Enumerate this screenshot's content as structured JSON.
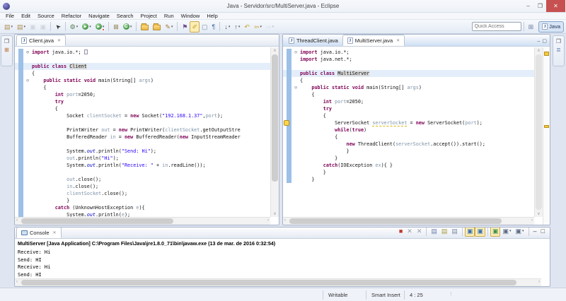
{
  "window": {
    "title": "Java - Servidor/src/MultiServer.java - Eclipse",
    "controls": [
      {
        "name": "minimize-button",
        "glyph": "–"
      },
      {
        "name": "maximize-button",
        "glyph": "❐"
      },
      {
        "name": "close-button",
        "glyph": "✕",
        "close": true
      }
    ]
  },
  "menu": {
    "items": [
      "File",
      "Edit",
      "Source",
      "Refactor",
      "Navigate",
      "Search",
      "Project",
      "Run",
      "Window",
      "Help"
    ]
  },
  "toolbar": {
    "quick_access_placeholder": "Quick Access",
    "perspective": {
      "label": "Java"
    },
    "open_perspective_icon": "⊞",
    "icons": [
      {
        "n": "new-wizard-dropdown",
        "g": "▤",
        "c": "#b08d4e",
        "d": 1
      },
      {
        "n": "new-project-dropdown",
        "g": "▤",
        "c": "#b08d4e",
        "d": 1
      },
      {
        "n": "save-button",
        "g": "▣",
        "c": "#9aa3b0",
        "dis": 1
      },
      {
        "n": "save-all-button",
        "g": "▣",
        "c": "#9aa3b0",
        "dis": 1
      },
      {
        "sep": 1
      },
      {
        "n": "selection-tool-button",
        "g": "➤",
        "c": "#333",
        "rot": -135
      },
      {
        "sep": 1
      },
      {
        "n": "debug-dropdown",
        "g": "⚙",
        "c": "#4f7b4f",
        "d": 1
      },
      {
        "n": "run-dropdown",
        "k": "run",
        "d": 1
      },
      {
        "n": "external-tools-dropdown",
        "k": "ext",
        "d": 1
      },
      {
        "sep": 1
      },
      {
        "n": "new-java-project-button",
        "g": "⊞",
        "c": "#8a6d3b"
      },
      {
        "n": "new-java-class-dropdown",
        "k": "class",
        "d": 1
      },
      {
        "sep": 1
      },
      {
        "n": "open-element-button",
        "k": "folder"
      },
      {
        "n": "open-resource-button",
        "k": "folder"
      },
      {
        "n": "new-task-dropdown",
        "g": "✎",
        "c": "#a8762e",
        "d": 1
      },
      {
        "sep": 1
      },
      {
        "n": "block-selection-toggle",
        "g": "⚑",
        "c": "#6d4c8f"
      },
      {
        "n": "mark-occurrences-toggle",
        "g": "✐",
        "c": "#c9a227",
        "p": 1
      },
      {
        "n": "show-selected-element-toggle",
        "g": "▢",
        "c": "#7a8aa5"
      },
      {
        "n": "show-whitespace-toggle",
        "g": "¶",
        "c": "#4a6fa5"
      },
      {
        "sep": 1
      },
      {
        "n": "next-annotation-dropdown",
        "g": "↓",
        "c": "#555",
        "d": 1
      },
      {
        "n": "previous-annotation-dropdown",
        "g": "↑",
        "c": "#555",
        "d": 1
      },
      {
        "n": "last-edit-location-button",
        "g": "↶",
        "c": "#c9a227"
      },
      {
        "n": "back-dropdown",
        "g": "⇦",
        "c": "#c9a227",
        "d": 1
      },
      {
        "n": "forward-dropdown",
        "g": "⇨",
        "c": "#b9c0cc",
        "d": 1,
        "dis": 1
      }
    ]
  },
  "minimized_panels": {
    "left": [
      {
        "name": "restore-view-icon",
        "g": "❐",
        "c": "#556"
      },
      {
        "name": "package-explorer-icon",
        "g": "⊞",
        "c": "#b5651d"
      }
    ],
    "right": [
      {
        "name": "restore-view-icon",
        "g": "❐",
        "c": "#556"
      },
      {
        "name": "outline-icon",
        "g": "≣",
        "c": "#4a6fa5"
      }
    ]
  },
  "editors": {
    "left": {
      "tabs": [
        {
          "label": "Client.java",
          "active": true
        }
      ],
      "lines": [
        {
          "fold": "plus",
          "seg": [
            [
              "import",
              "kw"
            ],
            [
              " java.io.*; ",
              "pl"
            ],
            [
              "",
              "foldbox"
            ]
          ]
        },
        {
          "seg": []
        },
        {
          "hl": true,
          "seg": [
            [
              "public",
              "kw"
            ],
            [
              " ",
              "pl"
            ],
            [
              "class",
              "kw"
            ],
            [
              " ",
              "pl"
            ],
            [
              "Client",
              "occ"
            ]
          ]
        },
        {
          "seg": [
            [
              "{",
              "pl"
            ]
          ]
        },
        {
          "fold": "minus",
          "seg": [
            [
              "    ",
              "pl"
            ],
            [
              "public",
              "kw"
            ],
            [
              " ",
              "pl"
            ],
            [
              "static",
              "kw"
            ],
            [
              " ",
              "pl"
            ],
            [
              "void",
              "kw"
            ],
            [
              " main(String[] ",
              "pl"
            ],
            [
              "args",
              "var"
            ],
            [
              ")",
              "pl"
            ]
          ]
        },
        {
          "seg": [
            [
              "    {",
              "pl"
            ]
          ]
        },
        {
          "seg": [
            [
              "        ",
              "pl"
            ],
            [
              "int",
              "kw"
            ],
            [
              " ",
              "pl"
            ],
            [
              "port",
              "var"
            ],
            [
              "=2050;",
              "pl"
            ]
          ]
        },
        {
          "seg": [
            [
              "        ",
              "pl"
            ],
            [
              "try",
              "kw"
            ]
          ]
        },
        {
          "seg": [
            [
              "        {",
              "pl"
            ]
          ]
        },
        {
          "seg": [
            [
              "            Socket ",
              "pl"
            ],
            [
              "clientSocket",
              "var"
            ],
            [
              " = ",
              "pl"
            ],
            [
              "new",
              "kw"
            ],
            [
              " Socket(",
              "pl"
            ],
            [
              "\"192.168.1.37\"",
              "str"
            ],
            [
              ",",
              "pl"
            ],
            [
              "port",
              "var"
            ],
            [
              ");",
              "pl"
            ]
          ]
        },
        {
          "seg": []
        },
        {
          "seg": [
            [
              "            PrintWriter ",
              "pl"
            ],
            [
              "out",
              "var"
            ],
            [
              " = ",
              "pl"
            ],
            [
              "new",
              "kw"
            ],
            [
              " PrintWriter(",
              "pl"
            ],
            [
              "clientSocket",
              "var"
            ],
            [
              ".getOutputStre",
              "pl"
            ]
          ]
        },
        {
          "seg": [
            [
              "            BufferedReader ",
              "pl"
            ],
            [
              "in",
              "var"
            ],
            [
              " = ",
              "pl"
            ],
            [
              "new",
              "kw"
            ],
            [
              " BufferedReader(",
              "pl"
            ],
            [
              "new",
              "kw"
            ],
            [
              " InputStreamReader",
              "pl"
            ]
          ]
        },
        {
          "seg": []
        },
        {
          "seg": [
            [
              "            System.",
              "pl"
            ],
            [
              "out",
              "fld"
            ],
            [
              ".println(",
              "pl"
            ],
            [
              "\"Send: Hi\"",
              "str"
            ],
            [
              ");",
              "pl"
            ]
          ]
        },
        {
          "seg": [
            [
              "            ",
              "pl"
            ],
            [
              "out",
              "var"
            ],
            [
              ".println(",
              "pl"
            ],
            [
              "\"Hi\"",
              "str"
            ],
            [
              ");",
              "pl"
            ]
          ]
        },
        {
          "seg": [
            [
              "            System.",
              "pl"
            ],
            [
              "out",
              "fld"
            ],
            [
              ".println(",
              "pl"
            ],
            [
              "\"Receive: \"",
              "str"
            ],
            [
              " + ",
              "pl"
            ],
            [
              "in",
              "var"
            ],
            [
              ".readLine());",
              "pl"
            ]
          ]
        },
        {
          "seg": []
        },
        {
          "seg": [
            [
              "            ",
              "pl"
            ],
            [
              "out",
              "var"
            ],
            [
              ".close();",
              "pl"
            ]
          ]
        },
        {
          "seg": [
            [
              "            ",
              "pl"
            ],
            [
              "in",
              "var"
            ],
            [
              ".close();",
              "pl"
            ]
          ]
        },
        {
          "seg": [
            [
              "            ",
              "pl"
            ],
            [
              "clientSocket",
              "var"
            ],
            [
              ".close();",
              "pl"
            ]
          ]
        },
        {
          "seg": [
            [
              "            }",
              "pl"
            ]
          ]
        },
        {
          "seg": [
            [
              "        ",
              "pl"
            ],
            [
              "catch",
              "kw"
            ],
            [
              " (UnknownHostException ",
              "pl"
            ],
            [
              "e",
              "var"
            ],
            [
              "){",
              "pl"
            ]
          ]
        },
        {
          "seg": [
            [
              "            System.",
              "pl"
            ],
            [
              "out",
              "fld"
            ],
            [
              ".println(",
              "pl"
            ],
            [
              "e",
              "var"
            ],
            [
              ");",
              "pl"
            ]
          ]
        }
      ]
    },
    "right": {
      "tabs": [
        {
          "label": "ThreadClient.java",
          "active": false
        },
        {
          "label": "MultiServer.java",
          "active": true
        }
      ],
      "lines": [
        {
          "fold": "minus",
          "seg": [
            [
              "import",
              "kw"
            ],
            [
              " java.io.*;",
              "pl"
            ]
          ]
        },
        {
          "seg": [
            [
              "import",
              "kw"
            ],
            [
              " java.net.*;",
              "pl"
            ]
          ]
        },
        {
          "seg": []
        },
        {
          "hl": true,
          "seg": [
            [
              "public",
              "kw"
            ],
            [
              " ",
              "pl"
            ],
            [
              "class",
              "kw"
            ],
            [
              " ",
              "pl"
            ],
            [
              "MultiServer",
              "occ"
            ]
          ]
        },
        {
          "seg": [
            [
              "{",
              "pl"
            ]
          ]
        },
        {
          "fold": "minus",
          "seg": [
            [
              "    ",
              "pl"
            ],
            [
              "public",
              "kw"
            ],
            [
              " ",
              "pl"
            ],
            [
              "static",
              "kw"
            ],
            [
              " ",
              "pl"
            ],
            [
              "void",
              "kw"
            ],
            [
              " main(String[] ",
              "pl"
            ],
            [
              "args",
              "var"
            ],
            [
              ")",
              "pl"
            ]
          ]
        },
        {
          "seg": [
            [
              "    {",
              "pl"
            ]
          ]
        },
        {
          "seg": [
            [
              "        ",
              "pl"
            ],
            [
              "int",
              "kw"
            ],
            [
              " ",
              "pl"
            ],
            [
              "port",
              "var"
            ],
            [
              "=2050;",
              "pl"
            ]
          ]
        },
        {
          "seg": [
            [
              "        ",
              "pl"
            ],
            [
              "try",
              "kw"
            ]
          ]
        },
        {
          "seg": [
            [
              "        {",
              "pl"
            ]
          ]
        },
        {
          "warn": true,
          "seg": [
            [
              "            ServerSocket ",
              "pl"
            ],
            [
              "serverSocket",
              "warnvar"
            ],
            [
              " = ",
              "pl"
            ],
            [
              "new",
              "kw"
            ],
            [
              " ServerSocket(",
              "pl"
            ],
            [
              "port",
              "var"
            ],
            [
              ");",
              "pl"
            ]
          ]
        },
        {
          "seg": [
            [
              "            ",
              "pl"
            ],
            [
              "while",
              "kw"
            ],
            [
              "(",
              "pl"
            ],
            [
              "true",
              "kw"
            ],
            [
              ")",
              "pl"
            ]
          ]
        },
        {
          "seg": [
            [
              "            {",
              "pl"
            ]
          ]
        },
        {
          "seg": [
            [
              "                ",
              "pl"
            ],
            [
              "new",
              "kw"
            ],
            [
              " ThreadClient(",
              "pl"
            ],
            [
              "serverSocket",
              "var"
            ],
            [
              ".accept()).start();",
              "pl"
            ]
          ]
        },
        {
          "seg": [
            [
              "                }",
              "pl"
            ]
          ]
        },
        {
          "seg": [
            [
              "            }",
              "pl"
            ]
          ]
        },
        {
          "seg": [
            [
              "        ",
              "pl"
            ],
            [
              "catch",
              "kw"
            ],
            [
              "(IOException ",
              "pl"
            ],
            [
              "ex",
              "var"
            ],
            [
              "){ }",
              "pl"
            ]
          ]
        },
        {
          "seg": [
            [
              "        }",
              "pl"
            ]
          ]
        },
        {
          "seg": [
            [
              "    }",
              "pl"
            ]
          ]
        }
      ]
    }
  },
  "console": {
    "tab": "Console",
    "label_line": "MultiServer [Java Application] C:\\Program Files\\Java\\jre1.8.0_71\\bin\\javaw.exe (13 de mar. de 2016 0:32:54)",
    "lines": [
      "Receive: Hi",
      "Send: HI",
      "Receive: Hi",
      "Send: HI"
    ],
    "icons": [
      {
        "n": "terminate-button",
        "g": "■",
        "c": "#c0392b"
      },
      {
        "n": "remove-launch-button",
        "g": "✕",
        "c": "#939aa5"
      },
      {
        "n": "remove-all-launches-button",
        "g": "✕",
        "c": "#939aa5"
      },
      {
        "sep": 1
      },
      {
        "n": "clear-console-button",
        "g": "▤",
        "c": "#6a7fae"
      },
      {
        "n": "scroll-lock-toggle",
        "g": "▤",
        "c": "#a59a3e"
      },
      {
        "n": "word-wrap-toggle",
        "g": "▤",
        "c": "#7a8aa5"
      },
      {
        "sep": 1
      },
      {
        "n": "show-stdout-toggle",
        "g": "▣",
        "c": "#3b6fae",
        "p": 1
      },
      {
        "n": "show-stderr-toggle",
        "g": "▣",
        "c": "#3b6fae",
        "p": 1
      },
      {
        "sep": 1
      },
      {
        "n": "pin-console-toggle",
        "g": "▣",
        "c": "#3f8f4f",
        "p": 1
      },
      {
        "n": "display-console-dropdown",
        "g": "▣",
        "c": "#5a6a85",
        "d": 1
      },
      {
        "n": "open-console-dropdown",
        "g": "▣",
        "c": "#5a6a85",
        "d": 1
      },
      {
        "sep": 1
      },
      {
        "n": "minimize-view-button",
        "g": "–",
        "c": "#444"
      },
      {
        "n": "maximize-view-button",
        "g": "□",
        "c": "#444"
      }
    ]
  },
  "status_bar": {
    "writable": "Writable",
    "input_mode": "Smart Insert",
    "cursor_position": "4 : 25"
  },
  "colors": {
    "keyword": "#7f0055",
    "string": "#2a00ff",
    "static_field": "#0000c0",
    "variable": "#7e93a8",
    "occurrence_bg": "#d9d9d9",
    "current_line_bg": "#e4eefa",
    "quick_diff": "#9cc0e7",
    "close_button": "#c75050",
    "accent": "#3b6fae"
  }
}
